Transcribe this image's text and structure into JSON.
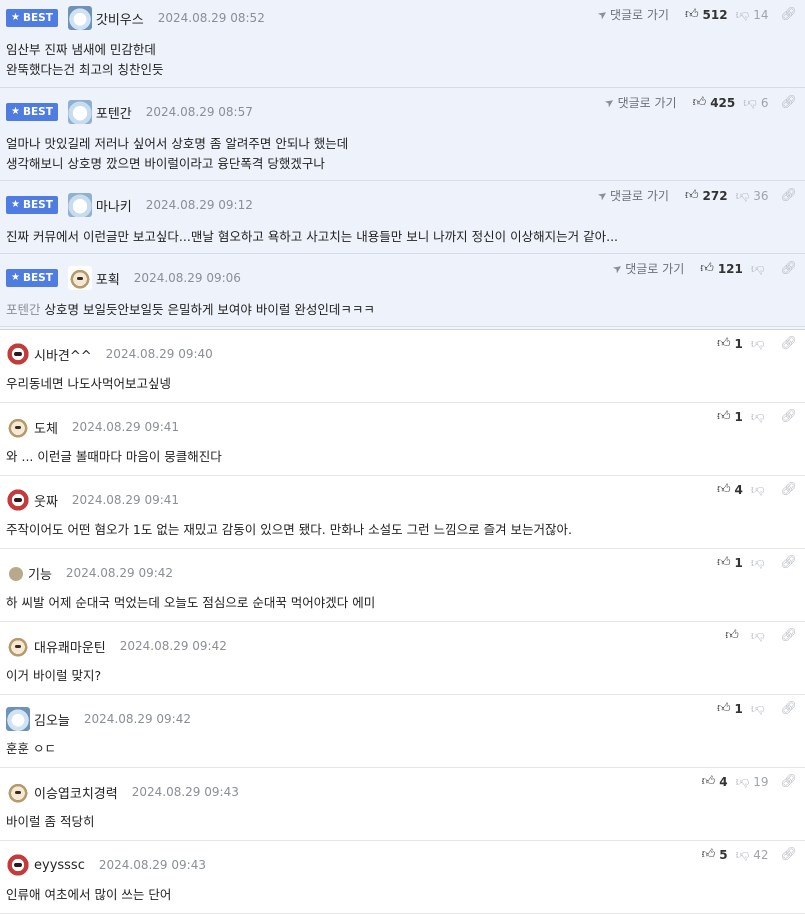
{
  "labels": {
    "best": "BEST",
    "reply": "댓글로 가기"
  },
  "best_comments": [
    {
      "nick": "갓비우스",
      "date": "2024.08.29 08:52",
      "avatar": "bear",
      "up": "512",
      "down": "14",
      "lines": [
        "임산부 진짜 냄새에 민감한데",
        "완뚝했다는건 최고의 칭찬인듯"
      ]
    },
    {
      "nick": "포텐간",
      "date": "2024.08.29 08:57",
      "avatar": "bear2",
      "up": "425",
      "down": "6",
      "lines": [
        "얼마나 맛있길레 저러나 싶어서 상호명 좀 알려주면 안되나 했는데",
        "생각해보니 상호명 깠으면 바이럴이라고 융단폭격 당했겠구나"
      ]
    },
    {
      "nick": "마나키",
      "date": "2024.08.29 09:12",
      "avatar": "bear2",
      "up": "272",
      "down": "36",
      "lines": [
        "진짜 커뮤에서 이런글만 보고싶다...맨날 혐오하고 욕하고 사고치는 내용들만 보니 나까지 정신이 이상해지는거 같아..."
      ]
    },
    {
      "nick": "포획",
      "date": "2024.08.29 09:06",
      "avatar": "dog",
      "up": "121",
      "down": "",
      "mention": "포텐간",
      "lines": [
        "상호명 보일듯안보일듯 은밀하게 보여야 바이럴 완성인데ㅋㅋㅋ"
      ]
    }
  ],
  "comments": [
    {
      "nick": "시바견^^",
      "date": "2024.08.29 09:40",
      "avatar": "red",
      "up": "1",
      "down": "",
      "text": "우리동네면 나도사먹어보고싶넹"
    },
    {
      "nick": "도체",
      "date": "2024.08.29 09:41",
      "avatar": "dog",
      "up": "1",
      "down": "",
      "text": "와 ... 이런글 볼때마다 마음이 뭉클해진다"
    },
    {
      "nick": "웃짜",
      "date": "2024.08.29 09:41",
      "avatar": "red",
      "up": "4",
      "down": "",
      "text": "주작이어도 어떤 혐오가 1도 없는 재밌고 감동이 있으면 됐다. 만화나 소설도 그런 느낌으로 즐겨 보는거잖아."
    },
    {
      "nick": "기능",
      "date": "2024.08.29 09:42",
      "avatar": "dot",
      "up": "1",
      "down": "",
      "text": "하 씨발 어제 순대국 먹었는데 오늘도 점심으로 순대꾹 먹어야겠다 에미"
    },
    {
      "nick": "대유쾌마운틴",
      "date": "2024.08.29 09:42",
      "avatar": "dog",
      "up": "",
      "down": "",
      "text": "이거 바이럴 맞지?"
    },
    {
      "nick": "김오늘",
      "date": "2024.08.29 09:42",
      "avatar": "bear",
      "up": "1",
      "down": "",
      "text": "훈훈 ㅇㄷ"
    },
    {
      "nick": "이승엽코치경력",
      "date": "2024.08.29 09:43",
      "avatar": "dog",
      "up": "4",
      "down": "19",
      "text": "바이럴 좀 적당히"
    },
    {
      "nick": "eyysssc",
      "date": "2024.08.29 09:43",
      "avatar": "red",
      "up": "5",
      "down": "42",
      "text": "인류애 여초에서 많이 쓰는 단어"
    }
  ]
}
